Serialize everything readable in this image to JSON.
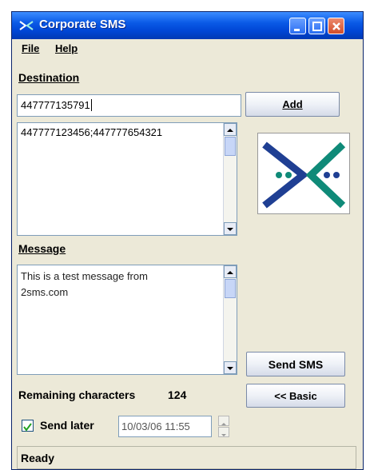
{
  "window": {
    "title": "Corporate SMS"
  },
  "menu": {
    "file": "File",
    "help": "Help"
  },
  "destination": {
    "label": "Destination",
    "input_value": "447777135791",
    "add_label": "Add",
    "list_text": "447777123456;447777654321"
  },
  "message": {
    "label": "Message",
    "text": "This is a test message from\n2sms.com",
    "send_label": "Send SMS"
  },
  "remaining": {
    "label": "Remaining characters",
    "count": "124"
  },
  "basic_label": "<< Basic",
  "send_later": {
    "label": "Send later",
    "checked": true,
    "datetime": "10/03/06 11:55"
  },
  "status": "Ready",
  "colors": {
    "title_blue": "#0a5ae6",
    "logo_blue": "#1f3f93",
    "logo_teal": "#0f8a78"
  }
}
